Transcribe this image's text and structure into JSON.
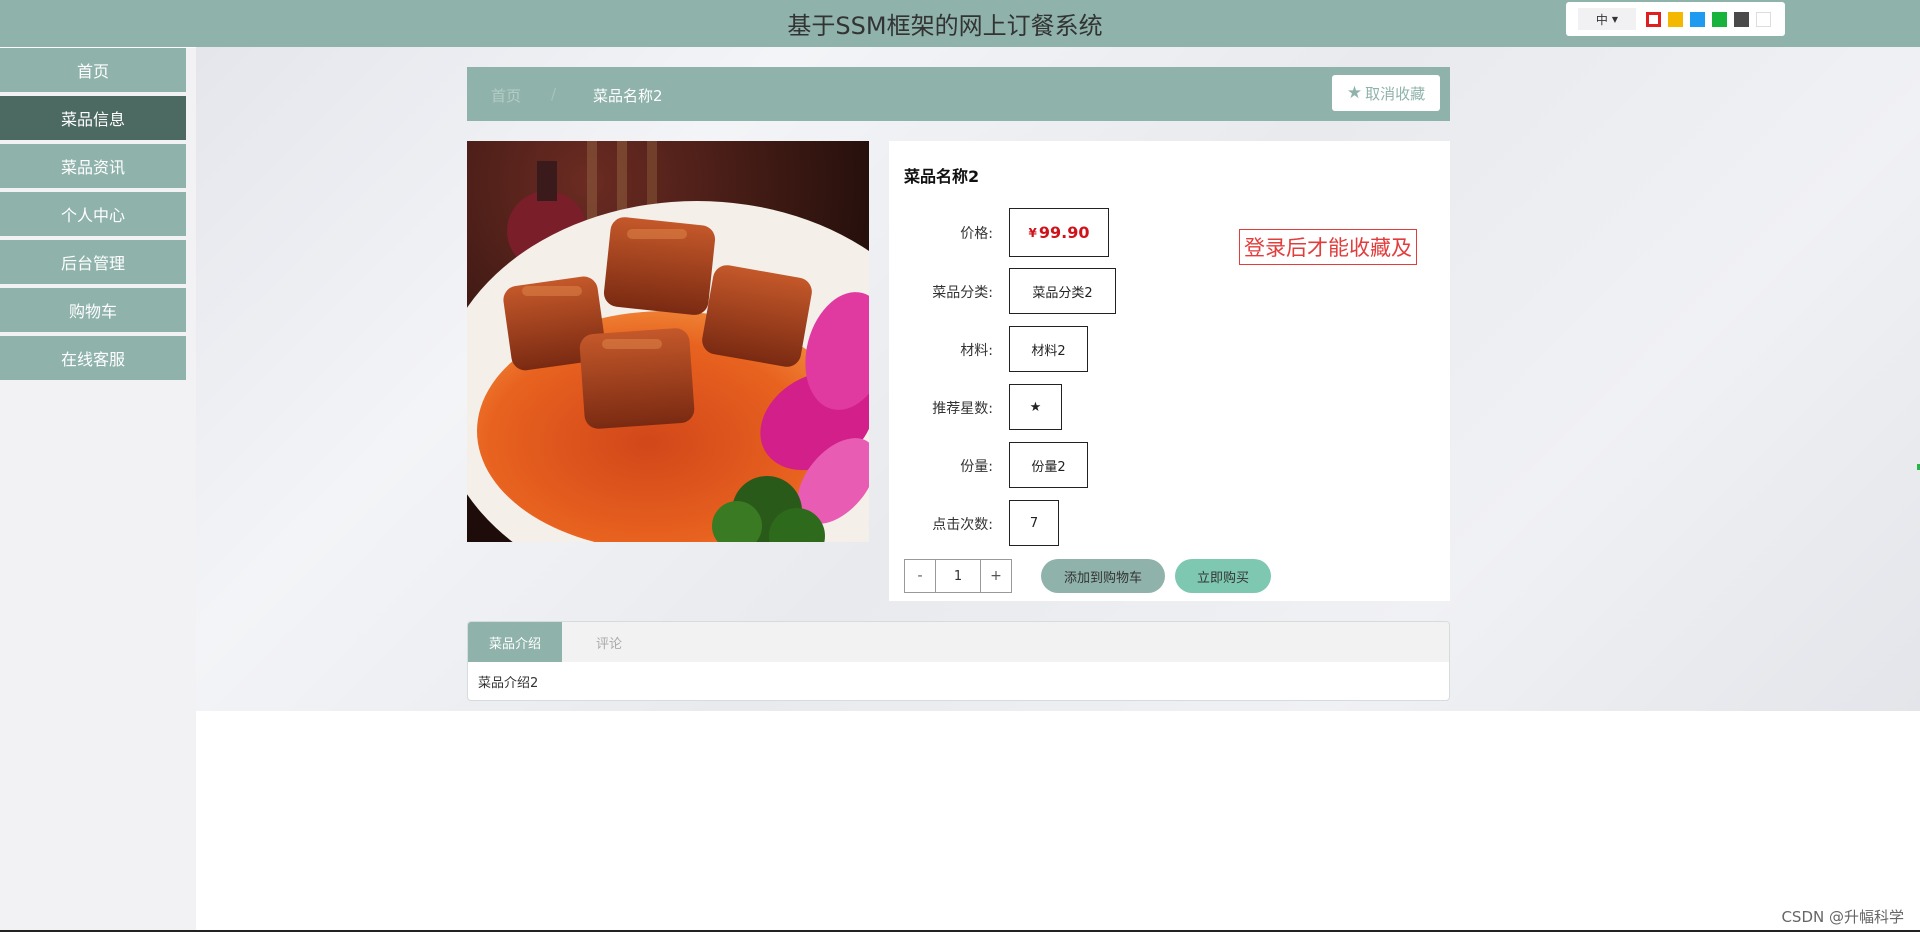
{
  "header": {
    "title": "基于SSM框架的网上订餐系统"
  },
  "theme": {
    "lang": "中",
    "swatches": [
      {
        "name": "red",
        "color": "#e02020",
        "selected": true
      },
      {
        "name": "yellow",
        "color": "#f5b800",
        "selected": false
      },
      {
        "name": "blue",
        "color": "#1e9bf0",
        "selected": false
      },
      {
        "name": "green",
        "color": "#17b33c",
        "selected": false
      },
      {
        "name": "dark",
        "color": "#4a4a4a",
        "selected": false
      },
      {
        "name": "white",
        "color": "#ffffff",
        "selected": false
      }
    ]
  },
  "sidebar": {
    "items": [
      {
        "label": "首页",
        "active": false
      },
      {
        "label": "菜品信息",
        "active": true
      },
      {
        "label": "菜品资讯",
        "active": false
      },
      {
        "label": "个人中心",
        "active": false
      },
      {
        "label": "后台管理",
        "active": false
      },
      {
        "label": "购物车",
        "active": false
      },
      {
        "label": "在线客服",
        "active": false
      }
    ]
  },
  "breadcrumb": {
    "home": "首页",
    "separator": "/",
    "current": "菜品名称2"
  },
  "favorite": {
    "label": "取消收藏",
    "icon": "star-icon"
  },
  "dish": {
    "name": "菜品名称2",
    "price_label": "价格:",
    "currency": "¥",
    "price": "99.90",
    "category_label": "菜品分类:",
    "category": "菜品分类2",
    "material_label": "材料:",
    "material": "材料2",
    "stars_label": "推荐星数:",
    "stars": "★",
    "portion_label": "份量:",
    "portion": "份量2",
    "clicks_label": "点击次数:",
    "clicks": "7",
    "login_note": "登录后才能收藏及"
  },
  "quantity": {
    "minus": "-",
    "value": "1",
    "plus": "+"
  },
  "actions": {
    "add_to_cart": "添加到购物车",
    "buy_now": "立即购买"
  },
  "tabs": {
    "items": [
      "菜品介绍",
      "评论"
    ],
    "active_index": 0,
    "content": "菜品介绍2"
  },
  "watermark": "CSDN @升幅科学"
}
